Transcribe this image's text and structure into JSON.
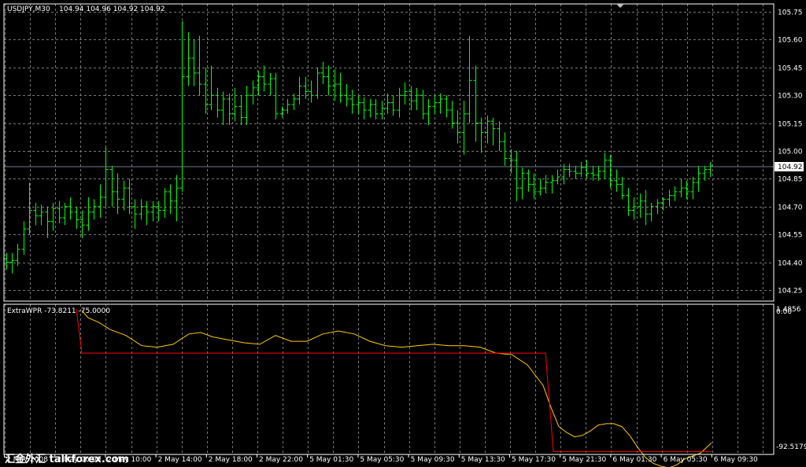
{
  "header": {
    "symbol": "USDJPY,M30",
    "ohlc": "104.94 104.96 104.92 104.92"
  },
  "indicator_header": "ExtraWPR -73.8211 -75.0000",
  "watermark": "汇金外汇 talkforex.com",
  "colors": {
    "background": "#000000",
    "grid": "#77777a",
    "bars": "#00ff00",
    "bid_line": "#6b7b8c",
    "wpr_line": "#ffcc00",
    "signal_line": "#ff0000",
    "text": "#ffffff"
  },
  "chart_data": [
    {
      "type": "ohlc",
      "title": "USDJPY,M30",
      "ylim": [
        104.2,
        105.8
      ],
      "yticks": [
        "105.75",
        "105.60",
        "105.45",
        "105.30",
        "105.15",
        "105.00",
        "104.85",
        "104.70",
        "104.55",
        "104.40",
        "104.25"
      ],
      "current_price": "104.92",
      "xticks": [
        "2 May 2008",
        "2 May 06:00",
        "2 May 10:00",
        "2 May 14:00",
        "2 May 18:00",
        "2 May 22:00",
        "5 May 01:30",
        "5 May 05:30",
        "5 May 09:30",
        "5 May 13:30",
        "5 May 17:30",
        "5 May 21:30",
        "6 May 01:30",
        "6 May 05:30",
        "6 May 09:30"
      ],
      "bars": [
        [
          104.42,
          104.45,
          104.36,
          104.4
        ],
        [
          104.4,
          104.45,
          104.34,
          104.41
        ],
        [
          104.41,
          104.5,
          104.38,
          104.47
        ],
        [
          104.47,
          104.62,
          104.44,
          104.58
        ],
        [
          104.58,
          104.83,
          104.55,
          104.68
        ],
        [
          104.68,
          104.72,
          104.6,
          104.65
        ],
        [
          104.65,
          104.71,
          104.6,
          104.67
        ],
        [
          104.67,
          104.7,
          104.53,
          104.62
        ],
        [
          104.62,
          104.72,
          104.57,
          104.69
        ],
        [
          104.69,
          104.73,
          104.61,
          104.64
        ],
        [
          104.64,
          104.72,
          104.6,
          104.7
        ],
        [
          104.7,
          104.75,
          104.63,
          104.67
        ],
        [
          104.67,
          104.7,
          104.58,
          104.63
        ],
        [
          104.63,
          104.68,
          104.53,
          104.6
        ],
        [
          104.6,
          104.75,
          104.57,
          104.67
        ],
        [
          104.67,
          104.74,
          104.63,
          104.7
        ],
        [
          104.7,
          104.82,
          104.64,
          104.75
        ],
        [
          104.75,
          105.02,
          104.7,
          104.9
        ],
        [
          104.9,
          104.92,
          104.7,
          104.78
        ],
        [
          104.78,
          104.88,
          104.66,
          104.74
        ],
        [
          104.74,
          104.84,
          104.68,
          104.8
        ],
        [
          104.8,
          104.85,
          104.66,
          104.7
        ],
        [
          104.7,
          104.74,
          104.58,
          104.66
        ],
        [
          104.66,
          104.74,
          104.63,
          104.7
        ],
        [
          104.7,
          104.73,
          104.6,
          104.67
        ],
        [
          104.67,
          104.73,
          104.62,
          104.7
        ],
        [
          104.7,
          104.73,
          104.62,
          104.68
        ],
        [
          104.68,
          104.8,
          104.64,
          104.78
        ],
        [
          104.78,
          104.82,
          104.66,
          104.73
        ],
        [
          104.73,
          104.87,
          104.62,
          104.8
        ],
        [
          104.8,
          105.7,
          104.78,
          105.4
        ],
        [
          105.4,
          105.64,
          105.35,
          105.5
        ],
        [
          105.5,
          105.6,
          105.35,
          105.42
        ],
        [
          105.42,
          105.62,
          105.3,
          105.36
        ],
        [
          105.36,
          105.45,
          105.2,
          105.25
        ],
        [
          105.25,
          105.46,
          105.22,
          105.3
        ],
        [
          105.3,
          105.34,
          105.18,
          105.22
        ],
        [
          105.22,
          105.32,
          105.14,
          105.28
        ],
        [
          105.28,
          105.31,
          105.14,
          105.2
        ],
        [
          105.2,
          105.34,
          105.16,
          105.24
        ],
        [
          105.24,
          105.3,
          105.14,
          105.18
        ],
        [
          105.18,
          105.35,
          105.14,
          105.3
        ],
        [
          105.3,
          105.38,
          105.25,
          105.34
        ],
        [
          105.34,
          105.43,
          105.3,
          105.4
        ],
        [
          105.4,
          105.46,
          105.32,
          105.36
        ],
        [
          105.36,
          105.42,
          105.3,
          105.39
        ],
        [
          105.39,
          105.42,
          105.17,
          105.2
        ],
        [
          105.2,
          105.24,
          105.18,
          105.22
        ],
        [
          105.22,
          105.28,
          105.2,
          105.25
        ],
        [
          105.25,
          105.31,
          105.22,
          105.28
        ],
        [
          105.28,
          105.4,
          105.25,
          105.35
        ],
        [
          105.35,
          105.4,
          105.28,
          105.32
        ],
        [
          105.32,
          105.38,
          105.26,
          105.3
        ],
        [
          105.3,
          105.45,
          105.28,
          105.42
        ],
        [
          105.42,
          105.48,
          105.36,
          105.4
        ],
        [
          105.4,
          105.46,
          105.3,
          105.35
        ],
        [
          105.35,
          105.44,
          105.27,
          105.36
        ],
        [
          105.36,
          105.42,
          105.26,
          105.3
        ],
        [
          105.3,
          105.36,
          105.24,
          105.28
        ],
        [
          105.28,
          105.33,
          105.2,
          105.25
        ],
        [
          105.25,
          105.3,
          105.2,
          105.26
        ],
        [
          105.26,
          105.29,
          105.17,
          105.22
        ],
        [
          105.22,
          105.28,
          105.18,
          105.25
        ],
        [
          105.25,
          105.28,
          105.17,
          105.2
        ],
        [
          105.2,
          105.27,
          105.17,
          105.23
        ],
        [
          105.23,
          105.31,
          105.2,
          105.26
        ],
        [
          105.26,
          105.3,
          105.19,
          105.22
        ],
        [
          105.22,
          105.34,
          105.18,
          105.3
        ],
        [
          105.3,
          105.37,
          105.25,
          105.32
        ],
        [
          105.32,
          105.35,
          105.22,
          105.27
        ],
        [
          105.27,
          105.34,
          105.22,
          105.3
        ],
        [
          105.3,
          105.33,
          105.17,
          105.2
        ],
        [
          105.2,
          105.28,
          105.14,
          105.24
        ],
        [
          105.24,
          105.3,
          105.2,
          105.26
        ],
        [
          105.26,
          105.31,
          105.2,
          105.28
        ],
        [
          105.28,
          105.3,
          105.18,
          105.22
        ],
        [
          105.22,
          105.27,
          105.12,
          105.15
        ],
        [
          105.15,
          105.22,
          105.04,
          105.1
        ],
        [
          105.1,
          105.27,
          104.98,
          105.2
        ],
        [
          105.2,
          105.62,
          105.15,
          105.38
        ],
        [
          105.38,
          105.46,
          105.05,
          105.15
        ],
        [
          105.15,
          105.18,
          104.99,
          105.1
        ],
        [
          105.1,
          105.19,
          105.04,
          105.16
        ],
        [
          105.16,
          105.18,
          105.03,
          105.12
        ],
        [
          105.12,
          105.16,
          105.0,
          105.05
        ],
        [
          105.05,
          105.1,
          104.92,
          104.96
        ],
        [
          104.96,
          105.01,
          104.88,
          104.95
        ],
        [
          104.95,
          105.0,
          104.73,
          104.8
        ],
        [
          104.8,
          104.91,
          104.74,
          104.88
        ],
        [
          104.88,
          104.9,
          104.78,
          104.82
        ],
        [
          104.82,
          104.88,
          104.74,
          104.78
        ],
        [
          104.78,
          104.85,
          104.76,
          104.8
        ],
        [
          104.8,
          104.87,
          104.77,
          104.83
        ],
        [
          104.83,
          104.87,
          104.77,
          104.84
        ],
        [
          104.84,
          104.9,
          104.82,
          104.86
        ],
        [
          104.86,
          104.93,
          104.82,
          104.9
        ],
        [
          104.9,
          104.93,
          104.86,
          104.89
        ],
        [
          104.89,
          104.92,
          104.85,
          104.88
        ],
        [
          104.88,
          104.94,
          104.86,
          104.91
        ],
        [
          104.91,
          104.95,
          104.85,
          104.88
        ],
        [
          104.88,
          104.92,
          104.84,
          104.87
        ],
        [
          104.87,
          104.92,
          104.84,
          104.89
        ],
        [
          104.89,
          104.99,
          104.85,
          104.95
        ],
        [
          104.95,
          104.98,
          104.8,
          104.84
        ],
        [
          104.84,
          104.9,
          104.78,
          104.82
        ],
        [
          104.82,
          104.86,
          104.74,
          104.76
        ],
        [
          104.76,
          104.8,
          104.65,
          104.68
        ],
        [
          104.68,
          104.75,
          104.63,
          104.7
        ],
        [
          104.7,
          104.77,
          104.64,
          104.73
        ],
        [
          104.73,
          104.79,
          104.6,
          104.66
        ],
        [
          104.66,
          104.72,
          104.62,
          104.7
        ],
        [
          104.7,
          104.74,
          104.66,
          104.72
        ],
        [
          104.72,
          104.75,
          104.68,
          104.74
        ],
        [
          104.74,
          104.79,
          104.7,
          104.76
        ],
        [
          104.76,
          104.81,
          104.73,
          104.78
        ],
        [
          104.78,
          104.85,
          104.75,
          104.8
        ],
        [
          104.8,
          104.84,
          104.74,
          104.78
        ],
        [
          104.78,
          104.86,
          104.74,
          104.83
        ],
        [
          104.83,
          104.92,
          104.78,
          104.88
        ],
        [
          104.88,
          104.92,
          104.84,
          104.9
        ],
        [
          104.9,
          104.94,
          104.86,
          104.92
        ]
      ]
    },
    {
      "type": "line",
      "title": "ExtraWPR -73.8211 -75.0000",
      "ylim": [
        -100,
        5
      ],
      "yticks": [
        "0.00",
        "-92.5179"
      ],
      "top_label": "1.4856",
      "series": [
        {
          "x": [
            104,
            112,
            125,
            140,
            160,
            180,
            200,
            220,
            240,
            255,
            270,
            290,
            310,
            330,
            350,
            370,
            390,
            410,
            430,
            450,
            470,
            490,
            510,
            530,
            550,
            570,
            590,
            610,
            630,
            650,
            670,
            690,
            700,
            710,
            720,
            730,
            740,
            750,
            760,
            770,
            780,
            790,
            800,
            810,
            820,
            830,
            840,
            850,
            860,
            870,
            880,
            890,
            904
          ],
          "y": [
            -1,
            -6,
            -9,
            -14,
            -18,
            -25,
            -26,
            -24,
            -17,
            -16,
            -19,
            -21,
            -23,
            -24,
            -18,
            -22,
            -22,
            -17,
            -15,
            -17,
            -22,
            -25,
            -26,
            -25,
            -24,
            -25,
            -25,
            -26,
            -30,
            -31,
            -38,
            -52,
            -67,
            -80,
            -84,
            -87,
            -86,
            -83,
            -79,
            -78,
            -78,
            -80,
            -86,
            -94,
            -101,
            -105,
            -107,
            -108,
            -106,
            -102,
            -100,
            -98,
            -91
          ]
        },
        {
          "x": [
            97,
            104,
            104,
            693,
            703,
            703,
            904
          ],
          "y": [
            0,
            -30,
            -30,
            -30,
            -97,
            -97,
            -97
          ]
        }
      ]
    }
  ]
}
